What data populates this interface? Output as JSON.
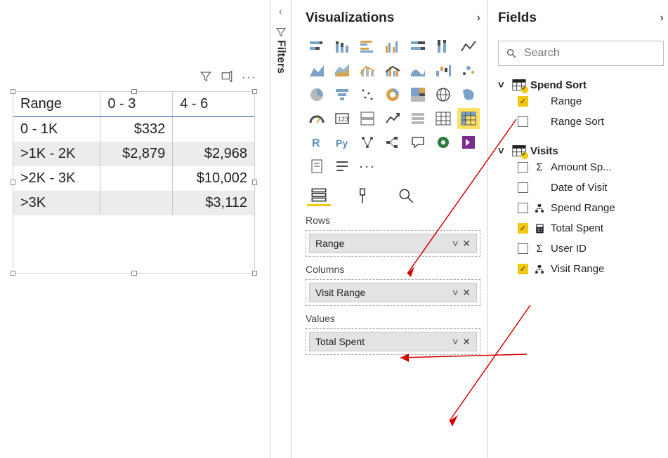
{
  "canvas": {
    "matrix": {
      "corner_label": "Range",
      "col_headers": [
        "0 - 3",
        "4 - 6"
      ],
      "rows": [
        {
          "label": "0 - 1K",
          "cells": [
            "$332",
            ""
          ]
        },
        {
          "label": ">1K - 2K",
          "cells": [
            "$2,879",
            "$2,968"
          ]
        },
        {
          "label": ">2K - 3K",
          "cells": [
            "",
            "$10,002"
          ]
        },
        {
          "label": ">3K",
          "cells": [
            "",
            "$3,112"
          ]
        }
      ]
    },
    "toolbar": {
      "filter_name": "filter-icon",
      "focus_name": "focus-mode-icon",
      "more_name": "more-options"
    }
  },
  "filters": {
    "label": "Filters"
  },
  "viz": {
    "title": "Visualizations",
    "wells": {
      "rows": {
        "label": "Rows",
        "item": "Range"
      },
      "columns": {
        "label": "Columns",
        "item": "Visit Range"
      },
      "values": {
        "label": "Values",
        "item": "Total Spent"
      }
    }
  },
  "fields": {
    "title": "Fields",
    "search_placeholder": "Search",
    "tables": [
      {
        "name": "Spend Sort",
        "fields": [
          {
            "name": "Range",
            "checked": true,
            "icon": ""
          },
          {
            "name": "Range Sort",
            "checked": false,
            "icon": ""
          }
        ]
      },
      {
        "name": "Visits",
        "fields": [
          {
            "name": "Amount Sp...",
            "checked": false,
            "icon": "Σ"
          },
          {
            "name": "Date of Visit",
            "checked": false,
            "icon": ""
          },
          {
            "name": "Spend Range",
            "checked": false,
            "icon": "hier"
          },
          {
            "name": "Total Spent",
            "checked": true,
            "icon": "calc"
          },
          {
            "name": "User ID",
            "checked": false,
            "icon": "Σ"
          },
          {
            "name": "Visit Range",
            "checked": true,
            "icon": "hier"
          }
        ]
      }
    ]
  },
  "chart_data": {
    "type": "table",
    "title": "Matrix visual – Total Spent by Range × Visit Range",
    "row_field": "Range",
    "column_field": "Visit Range",
    "value_field": "Total Spent",
    "columns": [
      "0 - 3",
      "4 - 6"
    ],
    "rows": [
      "0 - 1K",
      ">1K - 2K",
      ">2K - 3K",
      ">3K"
    ],
    "values": [
      [
        332,
        null
      ],
      [
        2879,
        2968
      ],
      [
        null,
        10002
      ],
      [
        null,
        3112
      ]
    ],
    "value_format": "$#,##0"
  }
}
